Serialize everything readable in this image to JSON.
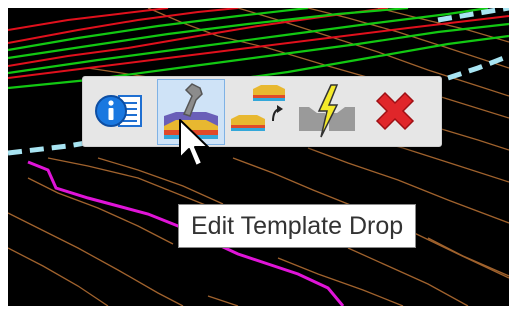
{
  "colors": {
    "background": "#000000",
    "contour_brown": "#a0622d",
    "alignment_red": "#e0101c",
    "alignment_green": "#12c812",
    "boundary_dashed": "#a8e4f2",
    "profile_magenta": "#e014d8",
    "toolbar_bg": "#e6e6e6",
    "selected_bg": "#cfe3f7"
  },
  "toolbar": {
    "buttons": [
      {
        "icon": "info-list-icon",
        "selected": false
      },
      {
        "icon": "edit-template-drop-icon",
        "selected": true
      },
      {
        "icon": "template-drop-transition-icon",
        "selected": false
      },
      {
        "icon": "template-drop-gap-icon",
        "selected": false
      },
      {
        "icon": "delete-x-icon",
        "selected": false
      }
    ]
  },
  "tooltip": {
    "text": "Edit Template Drop"
  },
  "cursor": {
    "icon": "arrow-pointer-icon"
  }
}
